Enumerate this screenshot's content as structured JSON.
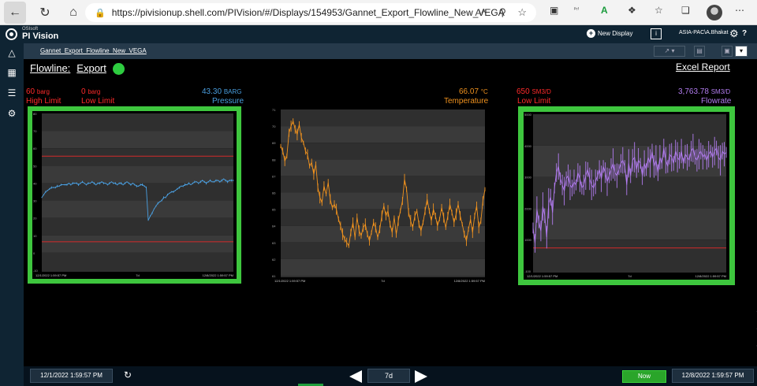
{
  "browser": {
    "url": "https://pivisionup.shell.com/PIVision/#/Displays/154953/Gannet_Export_Flowline_New_VEGA",
    "read_aloud": "Aᴬ",
    "ext_label": "ᴾᶜᶠ"
  },
  "app": {
    "brand_small": "OSIsoft",
    "brand": "PI Vision",
    "new_display": "New Display",
    "user": "ASIA-PAC\\A.Bhakat"
  },
  "display": {
    "tab_name": "Gannet_Export_Flowline_New_VEGA",
    "title_label": "Flowline:",
    "title_value": "Export",
    "excel_link": "Excel Report"
  },
  "pressure": {
    "high_limit_value": "60",
    "high_limit_unit": "barg",
    "high_limit_label": "High Limit",
    "low_limit_value": "0",
    "low_limit_unit": "barg",
    "low_limit_label": "Low Limit",
    "current_value": "43.30",
    "current_unit": "BARG",
    "name": "Pressure",
    "color": "#4a9fe0",
    "chart_data": {
      "type": "line",
      "ylim": [
        -20,
        90
      ],
      "yticks": [
        "80",
        "70",
        "60",
        "50",
        "40",
        "30",
        "20",
        "10",
        "0",
        "-10"
      ],
      "start_label": "12/1/2022 1:59:57 PM",
      "mid_label": "7d",
      "end_label": "12/8/2022 1:59:57 PM",
      "limits": [
        60,
        0
      ],
      "series": [
        {
          "values": [
            31,
            33,
            35,
            36,
            37,
            38,
            38,
            38,
            39,
            39,
            40,
            40,
            40,
            40,
            41,
            40,
            41,
            41,
            41,
            40,
            41,
            42,
            41,
            40,
            41,
            41,
            42,
            41,
            40,
            41,
            41,
            42,
            41,
            41,
            40,
            41,
            42,
            41,
            41,
            40,
            41,
            41,
            40,
            41,
            42,
            41,
            40,
            41,
            40,
            39,
            39,
            40,
            40,
            39,
            38,
            15,
            18,
            20,
            23,
            25,
            27,
            28,
            29,
            31,
            31,
            33,
            34,
            35,
            35,
            36,
            37,
            38,
            39,
            39,
            40,
            40,
            41,
            40,
            41,
            42,
            42,
            41,
            42,
            43,
            42,
            41,
            42,
            43,
            42,
            42,
            43,
            43,
            42,
            43,
            44,
            43,
            42,
            43,
            43,
            43
          ]
        }
      ]
    }
  },
  "temperature": {
    "current_value": "66.07",
    "current_unit": "°C",
    "name": "Temperature",
    "color": "#f0921e",
    "chart_data": {
      "type": "line",
      "ylim": [
        61,
        71
      ],
      "yticks": [
        "71",
        "70",
        "69",
        "68",
        "67",
        "66",
        "65",
        "64",
        "63",
        "62",
        "61"
      ],
      "start_label": "12/1/2022 1:59:57 PM",
      "mid_label": "7d",
      "end_label": "12/8/2022 1:59:57 PM",
      "series": [
        {
          "values": [
            68.8,
            68.5,
            67.9,
            68.2,
            69.6,
            70.0,
            70.3,
            69.8,
            69.5,
            70.1,
            69.3,
            69.0,
            68.5,
            68.3,
            67.6,
            67.8,
            67.1,
            67.7,
            66.3,
            65.7,
            65.4,
            66.4,
            65.9,
            66.6,
            65.6,
            65.1,
            65.3,
            65.0,
            64.4,
            64.0,
            63.5,
            63.2,
            63.0,
            62.8,
            63.6,
            64.2,
            63.3,
            64.5,
            63.7,
            63.4,
            63.9,
            64.1,
            63.5,
            63.1,
            63.6,
            64.2,
            63.9,
            63.3,
            63.8,
            64.6,
            65.2,
            64.6,
            64.9,
            64.1,
            63.6,
            64.5,
            63.5,
            64.3,
            64.9,
            65.5,
            66.8,
            66.2,
            64.8,
            64.3,
            63.9,
            64.6,
            64.9,
            64.1,
            63.7,
            64.2,
            64.9,
            65.6,
            64.9,
            64.3,
            65.0,
            64.6,
            64.0,
            64.4,
            65.1,
            64.5,
            63.9,
            64.6,
            65.3,
            64.8,
            64.2,
            64.7,
            65.3,
            64.6,
            64.1,
            63.5,
            63.1,
            63.8,
            64.4,
            63.6,
            64.6,
            65.2,
            63.9,
            64.3,
            65.5,
            66.2
          ]
        }
      ]
    }
  },
  "flowrate": {
    "low_limit_value": "650",
    "low_limit_unit": "SM3/D",
    "low_limit_label": "Low Limit",
    "current_value": "3,763.78",
    "current_unit": "SM3/D",
    "name": "Flowrate",
    "color": "#b27cf0",
    "chart_data": {
      "type": "line",
      "ylim": [
        -100,
        5000
      ],
      "yticks": [
        "5000",
        "4000",
        "3000",
        "2000",
        "1000",
        "-100"
      ],
      "start_label": "12/1/2022 1:59:57 PM",
      "mid_label": "7d",
      "end_label": "12/8/2022 1:59:57 PM",
      "limits": [
        650
      ],
      "series": [
        {
          "values": [
            1300,
            800,
            1900,
            1500,
            1200,
            2000,
            1700,
            1000,
            2100,
            2300,
            1800,
            2600,
            3100,
            3300,
            2900,
            2700,
            2500,
            2900,
            3000,
            2700,
            2600,
            2800,
            2700,
            3100,
            2900,
            2600,
            2700,
            3000,
            3200,
            2900,
            2700,
            2600,
            2800,
            3000,
            3200,
            2900,
            3300,
            3100,
            2800,
            3000,
            3200,
            3400,
            3100,
            3000,
            3200,
            3400,
            3500,
            3300,
            2700,
            3400,
            3000,
            3500,
            3600,
            3200,
            3500,
            3400,
            3000,
            3400,
            3200,
            3600,
            3400,
            3800,
            3300,
            3500,
            3100,
            3600,
            3400,
            3900,
            3500,
            3300,
            3700,
            3600,
            3400,
            3800,
            3600,
            3500,
            3800,
            3400,
            3700,
            3600,
            3500,
            3800,
            3900,
            3600,
            3500,
            3700,
            3800,
            3600,
            3700,
            3500,
            3700,
            3800,
            3600,
            3800,
            3900,
            3600,
            3500,
            3800,
            3700,
            3760
          ]
        }
      ]
    }
  },
  "timebar": {
    "start": "12/1/2022 1:59:57 PM",
    "duration": "7d",
    "now_label": "Now",
    "end": "12/8/2022 1:59:57 PM"
  },
  "colors": {
    "limit_line": "#d42a2a",
    "frame_green": "#3ec63e",
    "plot_bg_dark": "#2f2f2f",
    "plot_bg_light": "#3a3a3a"
  }
}
